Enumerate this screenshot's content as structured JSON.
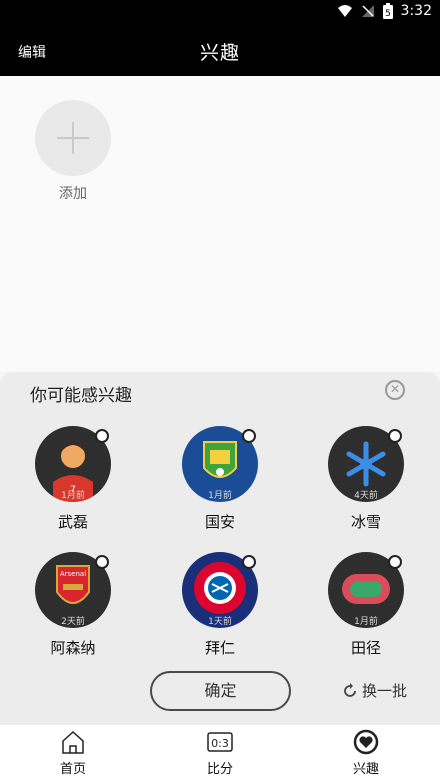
{
  "status": {
    "time": "3:32"
  },
  "header": {
    "edit": "编辑",
    "title": "兴趣"
  },
  "add": {
    "label": "添加"
  },
  "suggest": {
    "title": "你可能感兴趣",
    "items": [
      {
        "name": "武磊",
        "ago": "1月前"
      },
      {
        "name": "国安",
        "ago": "1月前"
      },
      {
        "name": "冰雪",
        "ago": "4天前"
      },
      {
        "name": "阿森纳",
        "ago": "2天前"
      },
      {
        "name": "拜仁",
        "ago": "1天前"
      },
      {
        "name": "田径",
        "ago": "1月前"
      }
    ],
    "confirm": "确定",
    "refresh": "换一批"
  },
  "nav": {
    "tabs": [
      {
        "label": "首页"
      },
      {
        "label": "比分"
      },
      {
        "label": "兴趣"
      }
    ]
  }
}
